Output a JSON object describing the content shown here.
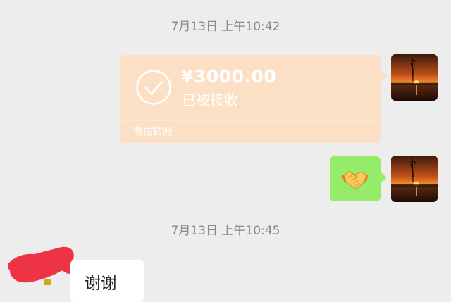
{
  "chat": {
    "timestamp_1": "7月13日 上午10:42",
    "timestamp_2": "7月13日 上午10:45",
    "transfer": {
      "amount": "¥3000.00",
      "status": "已被接收",
      "footer": "微信转账"
    },
    "incoming_message": {
      "text": "谢谢"
    }
  },
  "icons": {
    "transfer_status_icon": "check-circle-icon",
    "emoji_message": "handshake-emoji",
    "avatar": "sunset-lake-photo"
  },
  "colors": {
    "background": "#ededed",
    "transfer_card": "#fbe0c6",
    "sent_bubble": "#95ec69",
    "received_bubble": "#ffffff",
    "redaction": "#ee3344"
  }
}
